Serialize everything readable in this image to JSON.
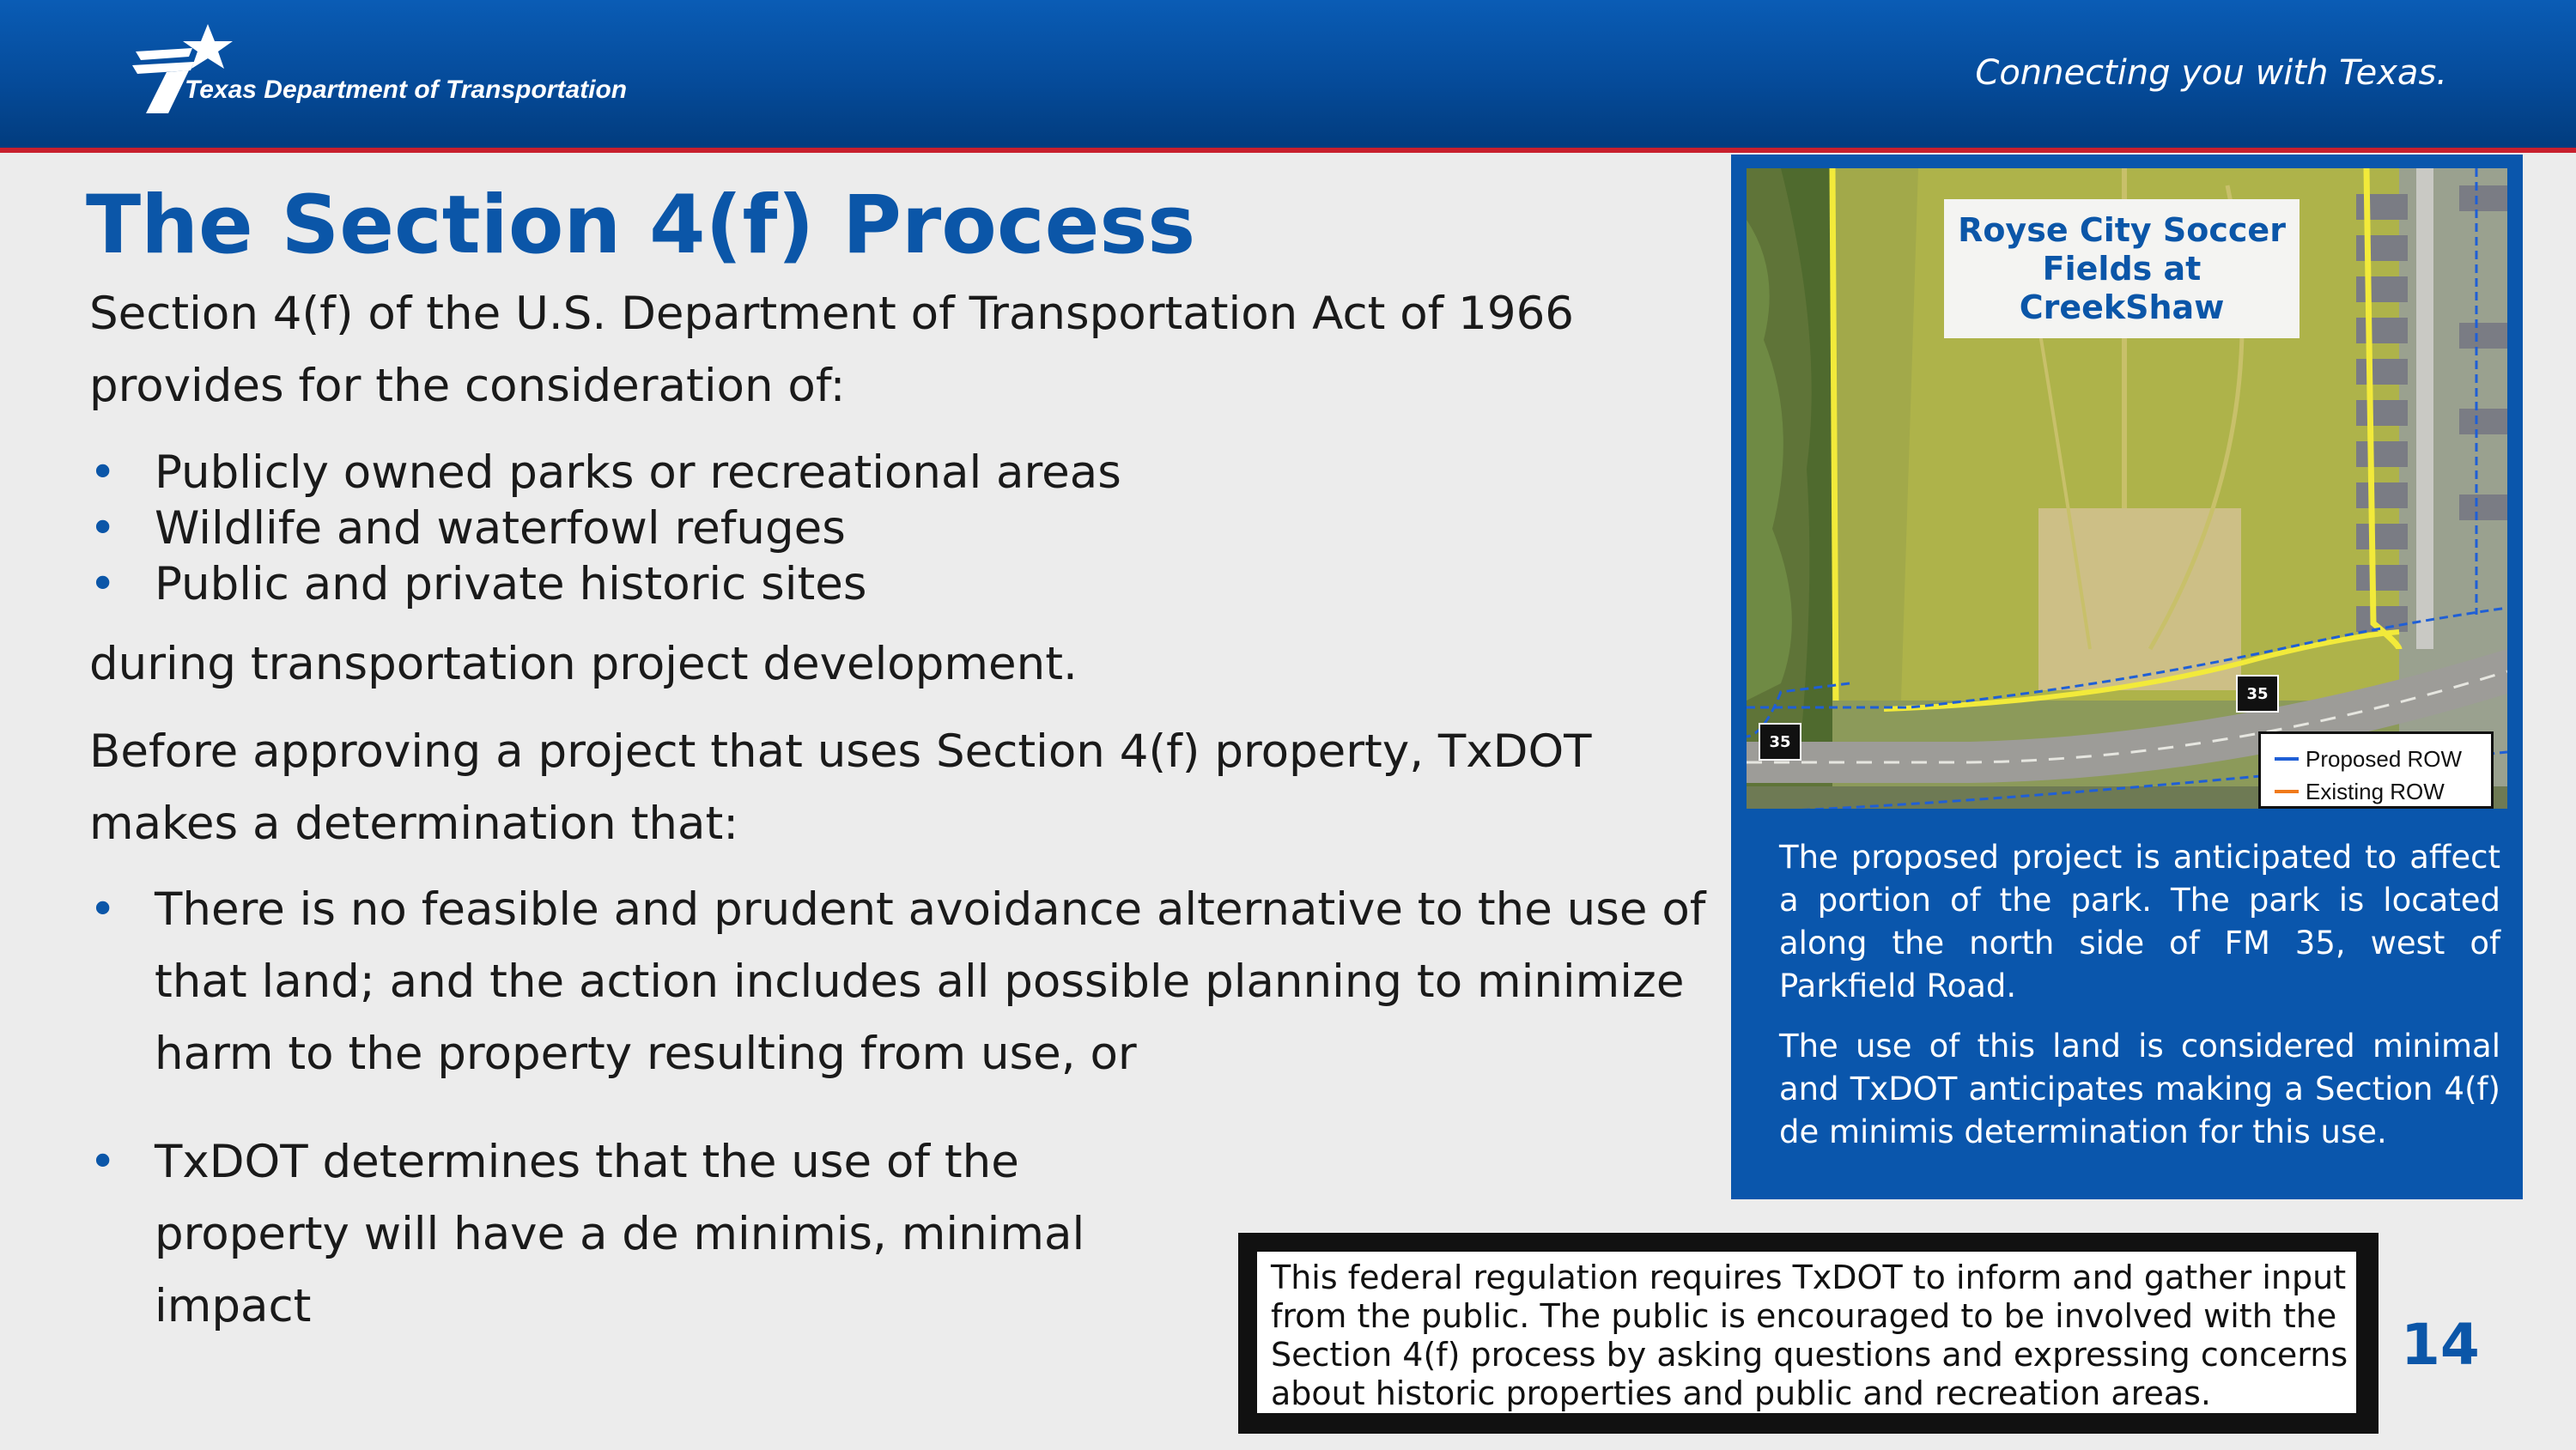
{
  "header": {
    "organization": "Texas Department of Transportation",
    "tagline": "Connecting you with Texas."
  },
  "title": "The Section 4(f) Process",
  "intro": "Section 4(f) of the U.S. Department of Transportation Act of 1966 provides for the consideration of:",
  "resources": [
    "Publicly owned parks or recreational areas",
    "Wildlife and waterfowl refuges",
    "Public and private historic sites"
  ],
  "during": "during transportation project development.",
  "before": "Before approving a project that uses Section 4(f) property, TxDOT makes a determination that:",
  "determinations": [
    "There is no feasible and prudent avoidance alternative to the use of that land; and the action includes all possible planning to minimize harm to the property resulting from use, or",
    "TxDOT determines that the use of the property will have a de minimis, minimal impact"
  ],
  "sidebar": {
    "map_label": "Royse City Soccer Fields at CreekShaw",
    "road_shield": "35",
    "legend": {
      "proposed": "Proposed ROW",
      "existing": "Existing ROW",
      "proposed_color": "#1f5fd6",
      "existing_color": "#f07a1a"
    },
    "paragraph1": "The proposed project is anticipated to affect a portion of the park. The park is located along the north side of FM 35, west of Parkfield Road.",
    "paragraph2": "The use of this land is considered minimal and TxDOT anticipates making a Section 4(f) de minimis determination for this use."
  },
  "notice": "This federal regulation requires TxDOT to inform and gather input from the public. The public is encouraged to be involved with the Section 4(f) process by asking questions and expressing concerns about historic properties and public and recreation areas.",
  "page_number": "14",
  "colors": {
    "brand_blue": "#0b56a8",
    "header_blue": "#054b9a",
    "accent_red": "#c8202e",
    "park_boundary": "#f2ea3a"
  }
}
